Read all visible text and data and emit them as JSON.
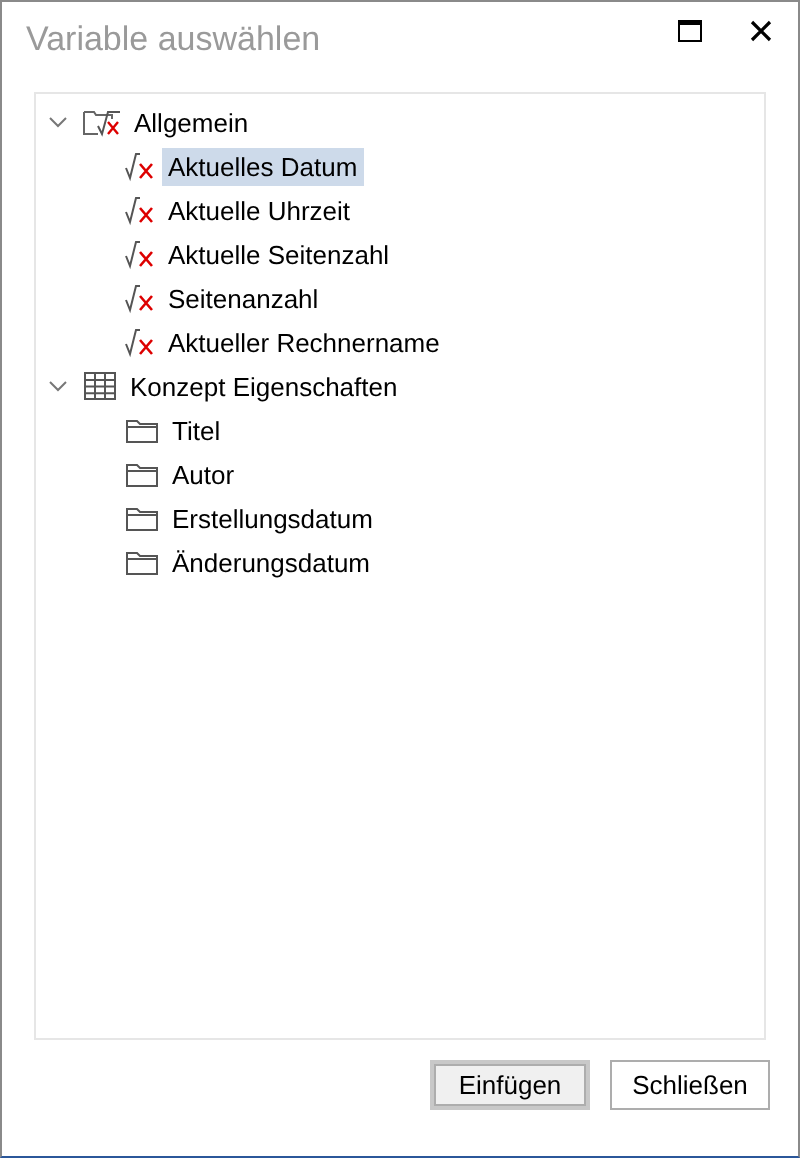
{
  "window": {
    "title": "Variable auswählen"
  },
  "tree": [
    {
      "label": "Allgemein",
      "kind": "formula-folder",
      "expanded": true,
      "selected": false,
      "children": [
        {
          "label": "Aktuelles Datum",
          "kind": "formula",
          "selected": true
        },
        {
          "label": "Aktuelle Uhrzeit",
          "kind": "formula",
          "selected": false
        },
        {
          "label": "Aktuelle Seitenzahl",
          "kind": "formula",
          "selected": false
        },
        {
          "label": "Seitenanzahl",
          "kind": "formula",
          "selected": false
        },
        {
          "label": "Aktueller Rechnername",
          "kind": "formula",
          "selected": false
        }
      ]
    },
    {
      "label": "Konzept Eigenschaften",
      "kind": "table",
      "expanded": true,
      "selected": false,
      "children": [
        {
          "label": "Titel",
          "kind": "folder",
          "selected": false
        },
        {
          "label": "Autor",
          "kind": "folder",
          "selected": false
        },
        {
          "label": "Erstellungsdatum",
          "kind": "folder",
          "selected": false
        },
        {
          "label": "Änderungsdatum",
          "kind": "folder",
          "selected": false
        }
      ]
    }
  ],
  "buttons": [
    {
      "label": "Einfügen",
      "default": true
    },
    {
      "label": "Schließen",
      "default": false
    }
  ]
}
